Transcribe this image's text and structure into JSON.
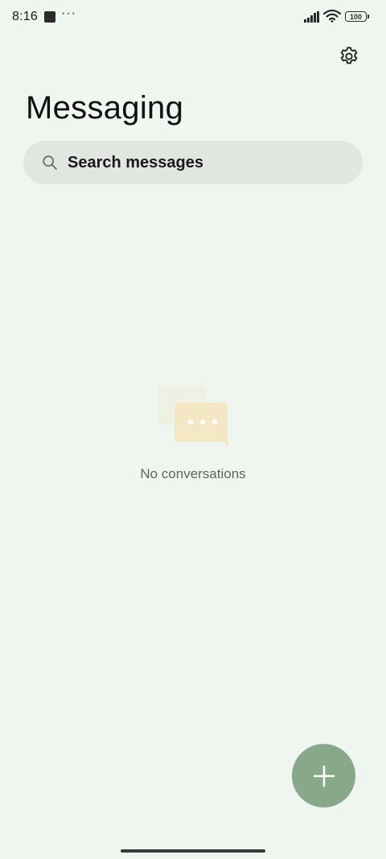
{
  "status_bar": {
    "time": "8:16",
    "more_indicator": "···",
    "battery_level": "100",
    "icons": [
      "app-notification-icon",
      "signal-icon",
      "wifi-icon",
      "battery-icon"
    ]
  },
  "header": {
    "settings_icon": "gear-icon",
    "title": "Messaging"
  },
  "search": {
    "placeholder": "Search messages",
    "icon": "search-icon"
  },
  "empty_state": {
    "icon": "chat-bubbles-icon",
    "text": "No conversations"
  },
  "fab": {
    "icon": "plus-icon",
    "color": "#87a98a"
  },
  "colors": {
    "background": "#eff5ef",
    "search_bg": "#e1e6e1",
    "accent": "#87a98a",
    "illustration_bubble": "#f4e8c4"
  }
}
